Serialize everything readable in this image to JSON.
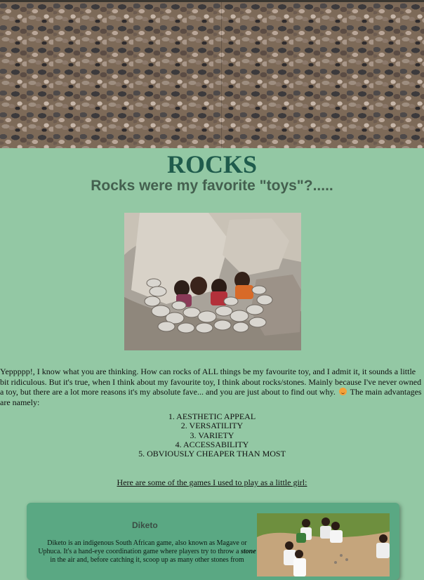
{
  "header": {
    "title": "ROCKS",
    "subtitle": "Rocks were my favorite \"toys\"?....."
  },
  "intro": {
    "text": "Yeppppp!, I know what you are thinking. How can rocks of ALL things be my favourite toy, and I admit it, it sounds a little bit ridiculous. But it's true, when I think about my favourite toy, I think about rocks/stones. Mainly because I've never owned a toy, but there are a lot more reasons it's my absolute fave... and you are just about to find out why.",
    "emoji": "smiling-face-icon",
    "text_after_emoji": " The main advantages are namely:"
  },
  "advantages": [
    "1. AESTHETIC APPEAL",
    "2. VERSATILITY",
    "3. VARIETY",
    "4. ACCESSABILITY",
    "5. OBVIOUSLY CHEAPER THAN MOST"
  ],
  "games_heading": "Here are some of the games I used to play as a little girl:",
  "game_card": {
    "title": "Diketo",
    "desc_part1": "Diketo is an indigenous South African game, also known as Magave or Uphuca. It's a hand-eye coordination game where players try to throw a ",
    "desc_emphasis": "stone",
    "desc_part2": " in the air and, before catching it, scoop up as many other stones from"
  },
  "colors": {
    "background": "#93c8a4",
    "title": "#1f5b4c",
    "card": "#5aa883"
  }
}
